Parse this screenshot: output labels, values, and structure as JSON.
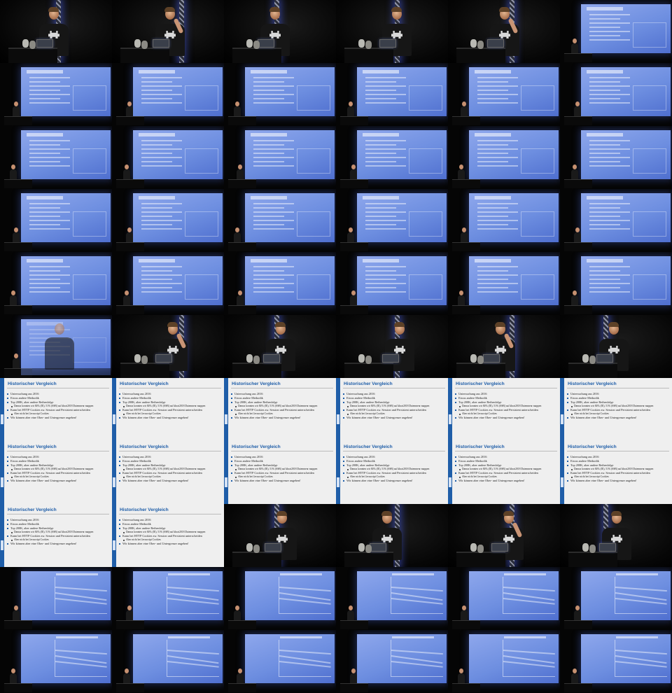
{
  "contact_sheet": {
    "columns": 6,
    "rows": 11,
    "tiles": [
      "stage",
      "stage",
      "stage",
      "stage",
      "stage",
      "screen",
      "screen",
      "screen",
      "screen",
      "screen",
      "screen",
      "screen",
      "screen",
      "screen",
      "screen",
      "screen",
      "screen",
      "screen",
      "screen",
      "screen",
      "screen",
      "screen",
      "screen",
      "screen",
      "screen",
      "screen",
      "screen",
      "screen",
      "screen",
      "screen",
      "screen-fade",
      "stage",
      "stage",
      "stage",
      "stage",
      "stage",
      "slide",
      "slide",
      "slide",
      "slide",
      "slide",
      "slide",
      "slide",
      "slide",
      "slide",
      "slide",
      "slide",
      "slide",
      "slide",
      "slide",
      "stage",
      "stage",
      "stage",
      "stage",
      "chart",
      "chart",
      "chart",
      "chart",
      "chart",
      "chart",
      "chart",
      "chart",
      "chart",
      "chart",
      "chart",
      "chart"
    ]
  },
  "slide": {
    "title": "Historischer Vergleich",
    "bullets": [
      {
        "text": "Untersuchung aus 2016",
        "level": 1
      },
      {
        "text": "Etwas andere Methodik",
        "level": 1
      },
      {
        "text": "Top 200K, aber andere Reihenfolge",
        "level": 1
      },
      {
        "text": "Damas konnten wir 84% (IE), 51% (SSB) auf khrai2018 Datenmenr mappen",
        "level": 2
      },
      {
        "text": "Kann bei HTTP Cookies zw. Session und Persistent unterscheiden",
        "level": 1
      },
      {
        "text": "Aber nicht bei Javascript Cookies",
        "level": 2
      },
      {
        "text": "Wir können aber eine Ober- und Untergrenze angeben!",
        "level": 1
      }
    ]
  },
  "colors": {
    "background": "#000000",
    "projector": "#6d8ee0",
    "slide_background": "#efefef",
    "slide_accent": "#1f5ea8",
    "truss_glow": "#4664dc"
  }
}
